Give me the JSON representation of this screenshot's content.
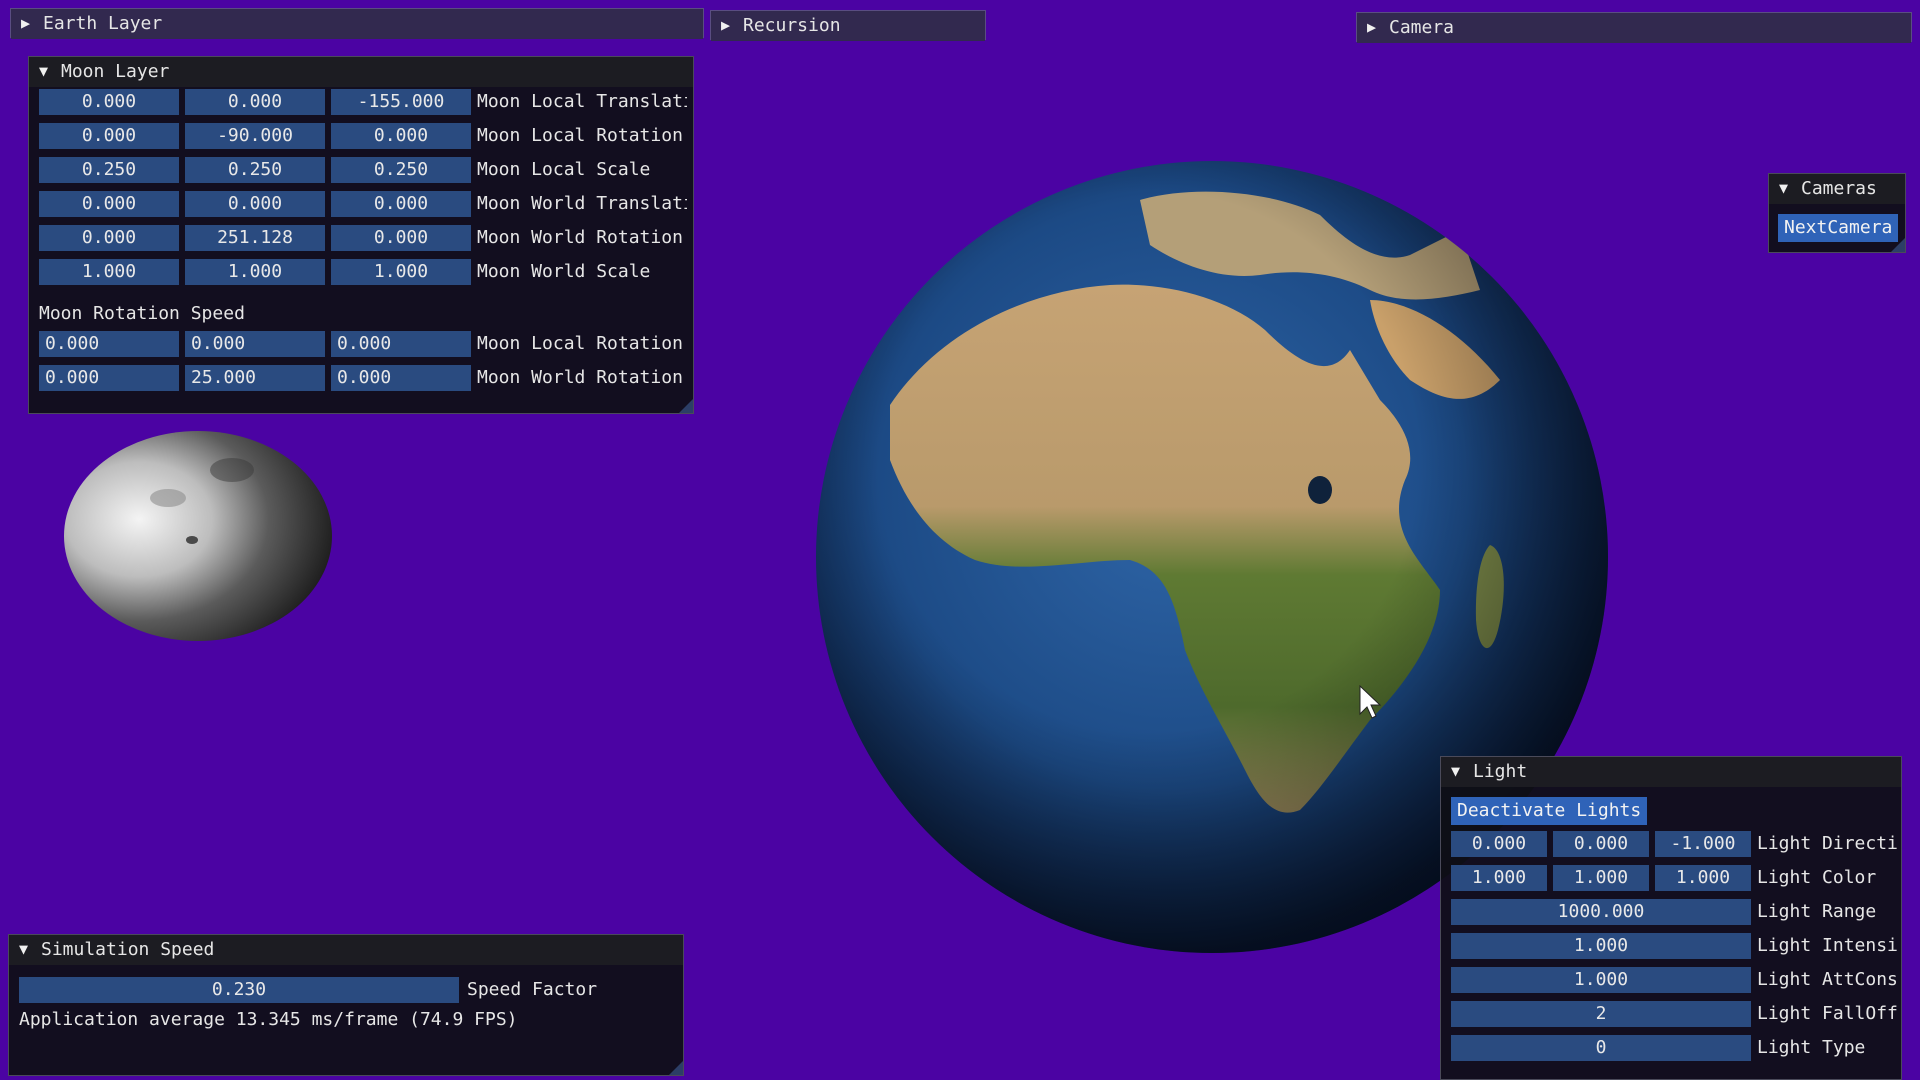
{
  "colors": {
    "background": "#4b03a3",
    "panel": "#0f0f16",
    "field": "#2a4b80",
    "button": "#2f63b8"
  },
  "icons": {
    "collapsed": "triangle-right-icon",
    "expanded": "triangle-down-icon",
    "cursor": "mouse-pointer-icon"
  },
  "earth_layer": {
    "title": "Earth Layer"
  },
  "recursion": {
    "title": "Recursion"
  },
  "camera": {
    "title": "Camera"
  },
  "moon_layer": {
    "title": "Moon Layer",
    "rows": [
      {
        "values": [
          "0.000",
          "0.000",
          "-155.000"
        ],
        "label": "Moon Local Translati"
      },
      {
        "values": [
          "0.000",
          "-90.000",
          "0.000"
        ],
        "label": "Moon Local Rotation"
      },
      {
        "values": [
          "0.250",
          "0.250",
          "0.250"
        ],
        "label": "Moon Local Scale"
      },
      {
        "values": [
          "0.000",
          "0.000",
          "0.000"
        ],
        "label": "Moon World Translati"
      },
      {
        "values": [
          "0.000",
          "251.128",
          "0.000"
        ],
        "label": "Moon World Rotation"
      },
      {
        "values": [
          "1.000",
          "1.000",
          "1.000"
        ],
        "label": "Moon World Scale"
      }
    ],
    "speed_heading": "Moon Rotation Speed",
    "speed_rows": [
      {
        "values": [
          "0.000",
          "0.000",
          "0.000"
        ],
        "label": "Moon Local Rotation"
      },
      {
        "values": [
          "0.000",
          "25.000",
          "0.000"
        ],
        "label": "Moon World Rotation"
      }
    ]
  },
  "cameras": {
    "title": "Cameras",
    "next_button": "NextCamera"
  },
  "light": {
    "title": "Light",
    "deactivate_button": "Deactivate Lights",
    "vector_rows": [
      {
        "values": [
          "0.000",
          "0.000",
          "-1.000"
        ],
        "label": "Light Directi"
      },
      {
        "values": [
          "1.000",
          "1.000",
          "1.000"
        ],
        "label": "Light Color"
      }
    ],
    "scalar_rows": [
      {
        "value": "1000.000",
        "label": "Light Range"
      },
      {
        "value": "1.000",
        "label": "Light Intensi"
      },
      {
        "value": "1.000",
        "label": "Light AttCons"
      },
      {
        "value": "2",
        "label": "Light FallOff"
      },
      {
        "value": "0",
        "label": "Light Type"
      }
    ]
  },
  "simulation_speed": {
    "title": "Simulation Speed",
    "speed_value": "0.230",
    "speed_label": "Speed Factor",
    "fps_text": "Application average 13.345 ms/frame (74.9 FPS)"
  }
}
